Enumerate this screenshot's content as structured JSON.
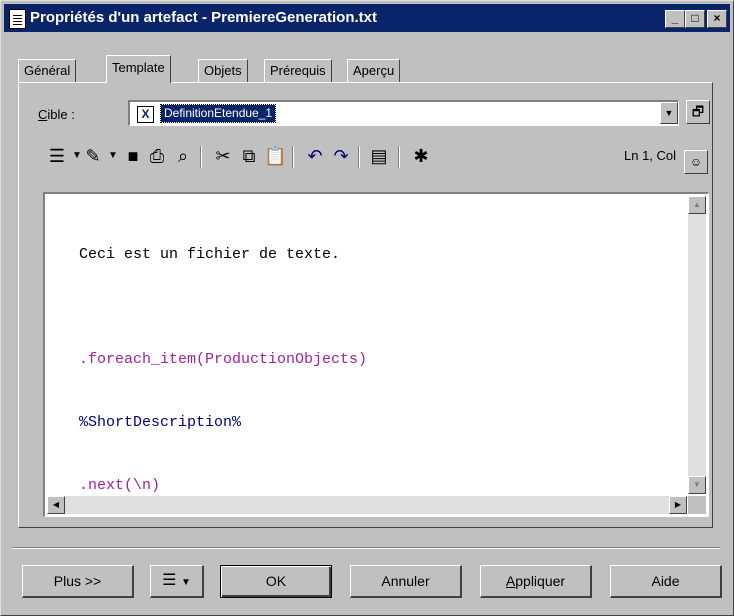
{
  "window": {
    "title": "Propriétés d'un artefact - PremiereGeneration.txt",
    "controls": {
      "minimize": "_",
      "maximize": "□",
      "close": "×"
    }
  },
  "tabs": [
    {
      "label": "Général",
      "active": false
    },
    {
      "label": "Template",
      "active": true
    },
    {
      "label": "Objets",
      "active": false
    },
    {
      "label": "Prérequis",
      "active": false
    },
    {
      "label": "Aperçu",
      "active": false
    }
  ],
  "cible": {
    "label_accel": "C",
    "label_rest": "ible :",
    "value": "DefinitionEtendue_1",
    "icon": "extended-definition-icon"
  },
  "toolbar": {
    "icons": [
      "properties-list-icon",
      "edit-icon",
      "save-icon",
      "print-icon",
      "find-icon",
      "cut-icon",
      "copy-icon",
      "paste-icon",
      "undo-icon",
      "redo-icon",
      "insert-file-icon",
      "insert-template-icon"
    ],
    "position_readout": "Ln 1, Col"
  },
  "editor": {
    "lines": [
      {
        "text": "Ceci est un fichier de texte.",
        "color": "#000000"
      },
      {
        "text": "",
        "color": "#000000"
      },
      {
        "text": ".foreach_item(ProductionObjects)",
        "color": "#a020a0"
      },
      {
        "text": "%ShortDescription%",
        "color": "#000080"
      },
      {
        "text": ".next(\\n)",
        "color": "#a020a0"
      }
    ]
  },
  "buttons": {
    "more": "Plus >>",
    "ok": "OK",
    "cancel": "Annuler",
    "apply_accel": "A",
    "apply_rest": "ppliquer",
    "help": "Aide"
  },
  "colors": {
    "titlebar": "#0a246a",
    "directive": "#a020a0",
    "variable": "#000080"
  }
}
